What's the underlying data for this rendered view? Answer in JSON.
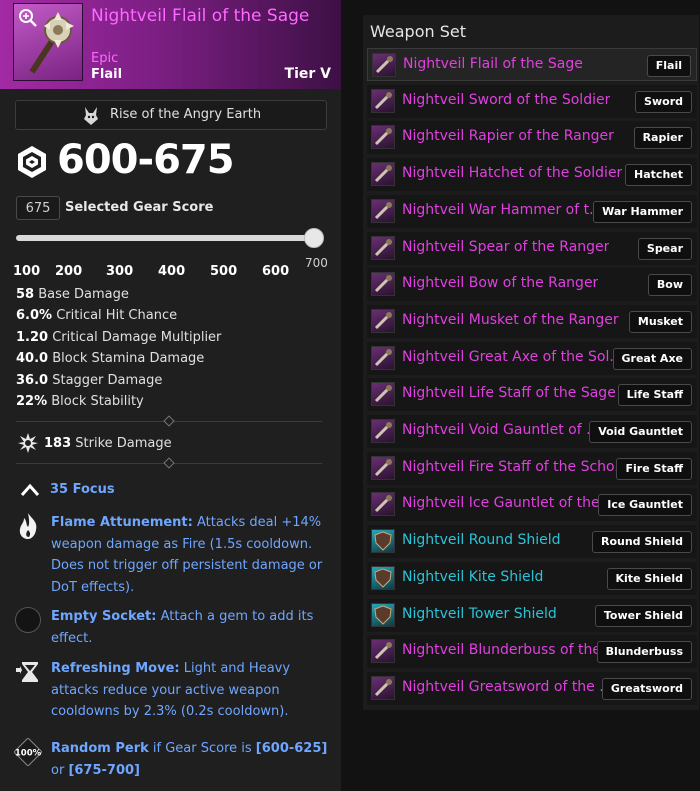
{
  "item": {
    "name": "Nightveil Flail of the Sage",
    "rarity": "Epic",
    "type": "Flail",
    "tier": "Tier V",
    "colors": {
      "rarity": "#ff69ff",
      "header_gradient_start": "#a22aa4"
    }
  },
  "expansion": {
    "label": "Rise of the Angry Earth",
    "icon": "wolf-head-icon"
  },
  "gear_score": {
    "range": "600-675",
    "selected_value": "675",
    "selected_label": "Selected Gear Score",
    "slider_min": 100,
    "slider_max": 700,
    "slider_value": 700,
    "slider_max_label": "700",
    "tick_labels": [
      "100",
      "200",
      "300",
      "400",
      "500",
      "600"
    ]
  },
  "stats": [
    {
      "value": "58",
      "label": "Base Damage"
    },
    {
      "value": "6.0%",
      "label": "Critical Hit Chance"
    },
    {
      "value": "1.20",
      "label": "Critical Damage Multiplier"
    },
    {
      "value": "40.0",
      "label": "Block Stamina Damage"
    },
    {
      "value": "36.0",
      "label": "Stagger Damage"
    },
    {
      "value": "22%",
      "label": "Block Stability"
    }
  ],
  "damage_type": {
    "value": "183",
    "label": "Strike Damage",
    "icon": "strike-burst-icon"
  },
  "attribute": {
    "text": "35 Focus",
    "icon": "chevron-up-icon"
  },
  "perks": [
    {
      "icon": "flame-icon",
      "title": "Flame Attunement:",
      "text": "Attacks deal +14% weapon damage as Fire (1.5s cooldown. Does not trigger off persistent damage or DoT effects)."
    },
    {
      "icon": "empty-socket-icon",
      "title": "Empty Socket:",
      "text": "Attach a gem to add its effect."
    },
    {
      "icon": "hourglass-icon",
      "title": "Refreshing Move:",
      "text": "Light and Heavy attacks reduce your active weapon cooldowns by 2.3% (0.2s cooldown)."
    },
    {
      "icon": "random-perk-icon",
      "badge": "100%",
      "title": "Random Perk",
      "text_pre": " if Gear Score is ",
      "text_range1": "[600-625]",
      "text_mid": " or ",
      "text_range2": "[675-700]"
    }
  ],
  "weapon_set": {
    "title": "Weapon Set",
    "colors": {
      "epic": "#e040e0",
      "shield": "#2bc4d6"
    },
    "items": [
      {
        "name": "Nightveil Flail of the Sage",
        "badge": "Flail",
        "color": "#e040e0",
        "icon": "flail-icon",
        "selected": true
      },
      {
        "name": "Nightveil Sword of the Soldier",
        "badge": "Sword",
        "color": "#e040e0",
        "icon": "sword-icon"
      },
      {
        "name": "Nightveil Rapier of the Ranger",
        "badge": "Rapier",
        "color": "#e040e0",
        "icon": "rapier-icon"
      },
      {
        "name": "Nightveil Hatchet of the Soldier",
        "badge": "Hatchet",
        "color": "#e040e0",
        "icon": "hatchet-icon"
      },
      {
        "name": "Nightveil War Hammer of t...",
        "badge": "War Hammer",
        "color": "#e040e0",
        "icon": "war-hammer-icon"
      },
      {
        "name": "Nightveil Spear of the Ranger",
        "badge": "Spear",
        "color": "#e040e0",
        "icon": "spear-icon"
      },
      {
        "name": "Nightveil Bow of the Ranger",
        "badge": "Bow",
        "color": "#e040e0",
        "icon": "bow-icon"
      },
      {
        "name": "Nightveil Musket of the Ranger",
        "badge": "Musket",
        "color": "#e040e0",
        "icon": "musket-icon"
      },
      {
        "name": "Nightveil Great Axe of the Sol...",
        "badge": "Great Axe",
        "color": "#e040e0",
        "icon": "great-axe-icon"
      },
      {
        "name": "Nightveil Life Staff of the Sage",
        "badge": "Life Staff",
        "color": "#e040e0",
        "icon": "life-staff-icon"
      },
      {
        "name": "Nightveil Void Gauntlet of ...",
        "badge": "Void Gauntlet",
        "color": "#e040e0",
        "icon": "void-gauntlet-icon"
      },
      {
        "name": "Nightveil Fire Staff of the Scho...",
        "badge": "Fire Staff",
        "color": "#e040e0",
        "icon": "fire-staff-icon"
      },
      {
        "name": "Nightveil Ice Gauntlet of the...",
        "badge": "Ice Gauntlet",
        "color": "#e040e0",
        "icon": "ice-gauntlet-icon"
      },
      {
        "name": "Nightveil Round Shield",
        "badge": "Round Shield",
        "color": "#2bc4d6",
        "icon": "round-shield-icon"
      },
      {
        "name": "Nightveil Kite Shield",
        "badge": "Kite Shield",
        "color": "#2bc4d6",
        "icon": "kite-shield-icon"
      },
      {
        "name": "Nightveil Tower Shield",
        "badge": "Tower Shield",
        "color": "#2bc4d6",
        "icon": "tower-shield-icon"
      },
      {
        "name": "Nightveil Blunderbuss of the...",
        "badge": "Blunderbuss",
        "color": "#e040e0",
        "icon": "blunderbuss-icon"
      },
      {
        "name": "Nightveil Greatsword of the ...",
        "badge": "Greatsword",
        "color": "#e040e0",
        "icon": "greatsword-icon"
      }
    ]
  }
}
